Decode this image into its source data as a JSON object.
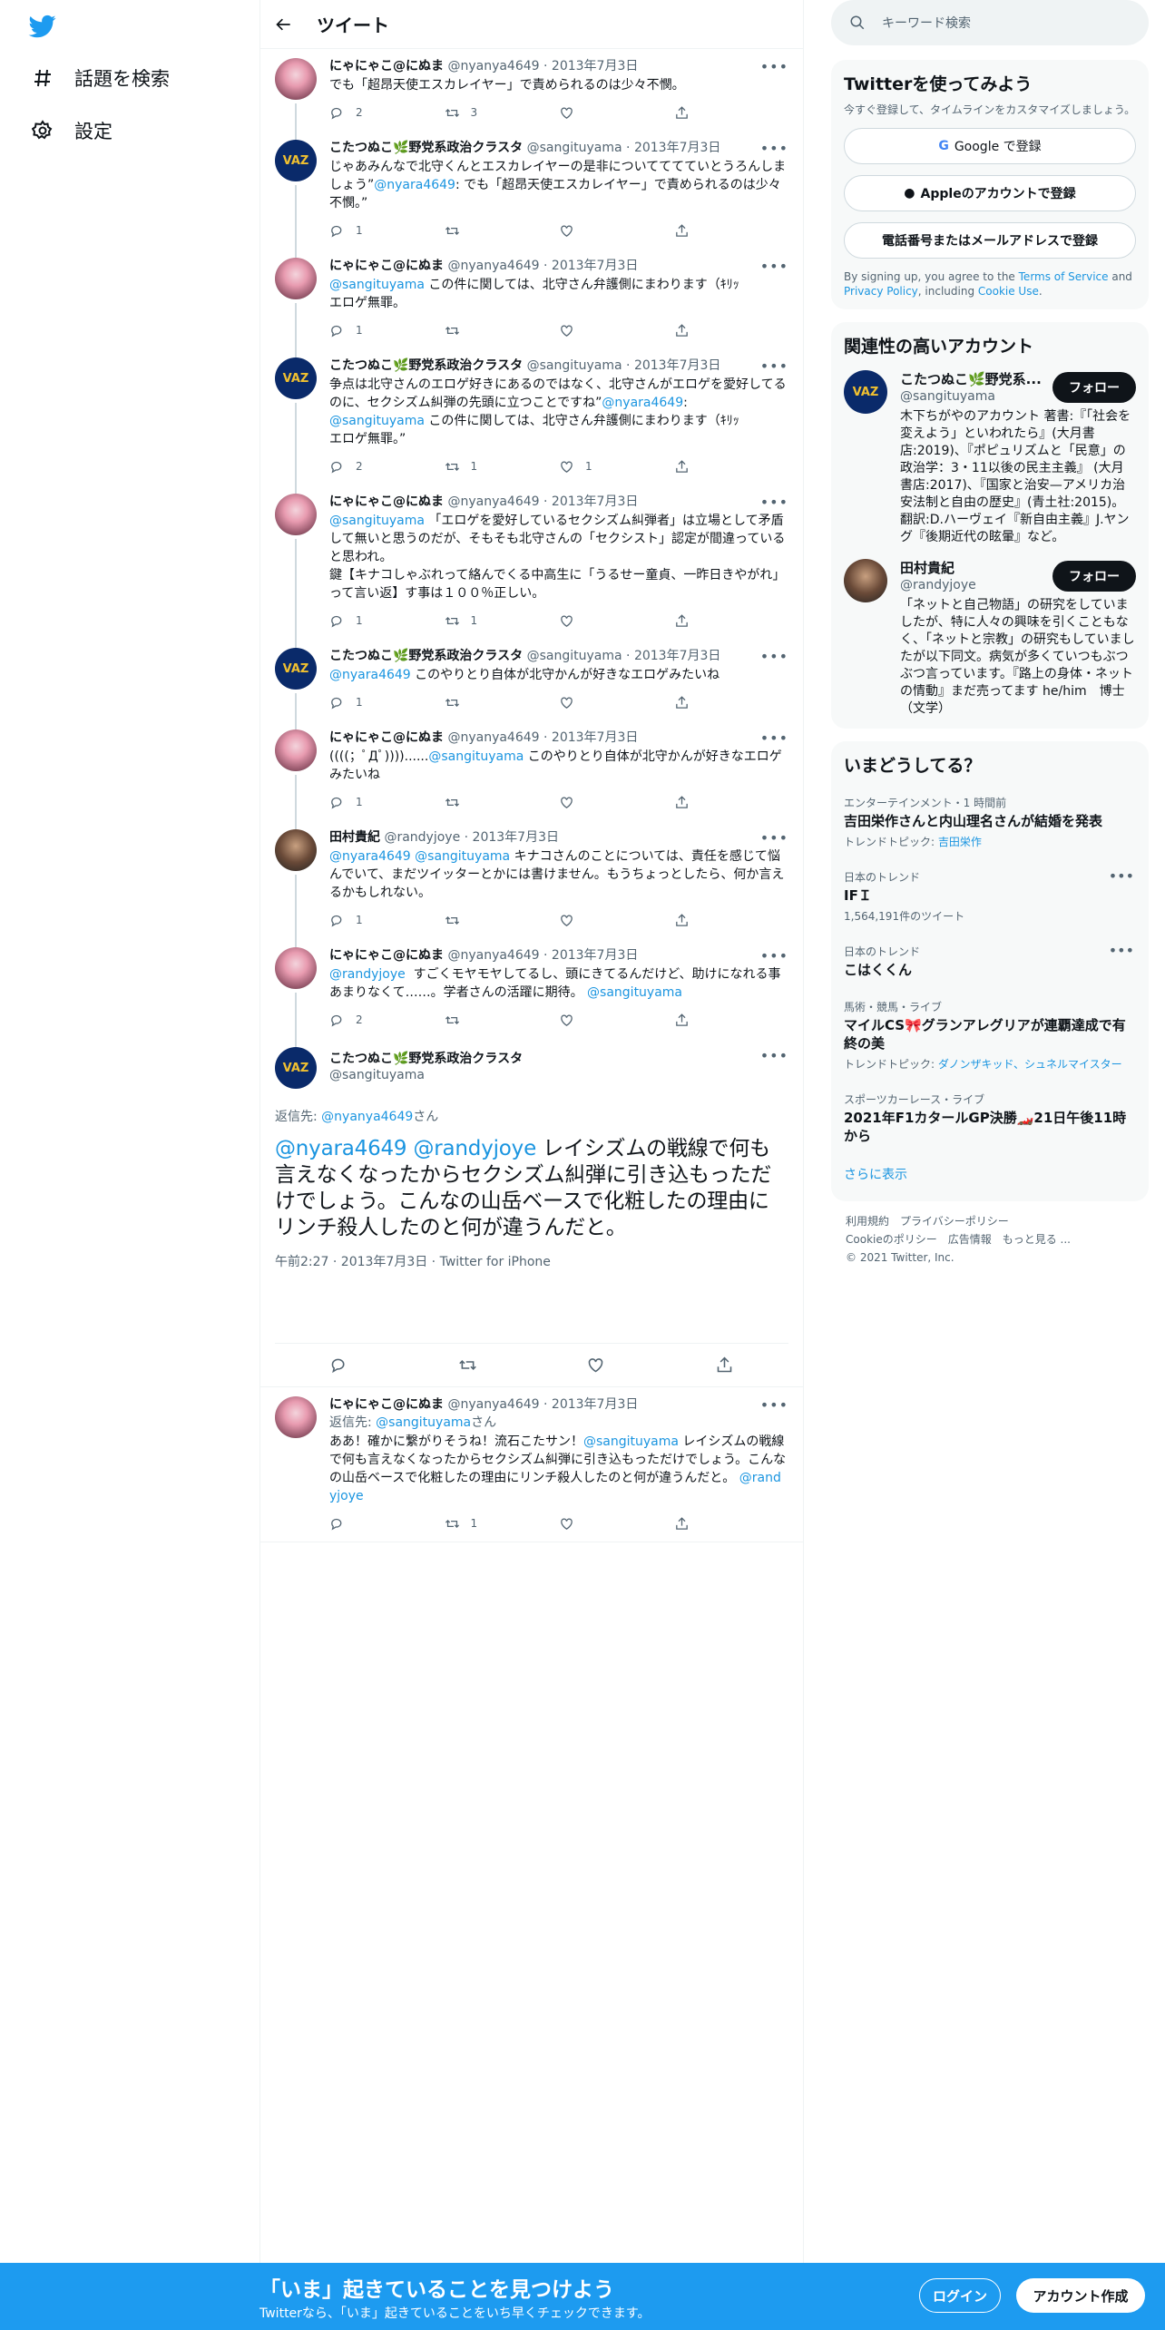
{
  "nav": {
    "explore": "話題を検索",
    "settings": "設定"
  },
  "header": {
    "title": "ツイート"
  },
  "tweets": [
    {
      "name": "にゃにゃこ@にぬま",
      "handle": "@nyanya4649",
      "date": "2013年7月3日",
      "text": "でも「超昂天使エスカレイヤー」で責められるのは少々不憫。",
      "reply": "2",
      "rt": "3",
      "like": ""
    },
    {
      "name": "こたつぬこ🌿野党系政治クラスタ",
      "handle": "@sangituyama",
      "date": "2013年7月3日",
      "text_pre": "じゃあみんなで北守くんとエスカレイヤーの是非についてててていとうろんしましょう”",
      "mention": "@nyara4649",
      "text_post": ": でも「超昂天使エスカレイヤー」で責められるのは少々不憫。”",
      "reply": "1",
      "rt": "",
      "like": ""
    },
    {
      "name": "にゃにゃこ@にぬま",
      "handle": "@nyanya4649",
      "date": "2013年7月3日",
      "mention": "@sangituyama",
      "text": " この件に関しては、北守さん弁護側にまわります（ｷﾘｯ\nエロゲ無罪。",
      "reply": "1",
      "rt": "",
      "like": ""
    },
    {
      "name": "こたつぬこ🌿野党系政治クラスタ",
      "handle": "@sangituyama",
      "date": "2013年7月3日",
      "text_pre": "争点は北守さんのエロゲ好きにあるのではなく、北守さんがエロゲを愛好してるのに、セクシズム糾弾の先頭に立つことですね”",
      "mention": "@nyara4649",
      "text_mid": ":\n",
      "mention2": "@sangituyama",
      "text_post": " この件に関しては、北守さん弁護側にまわります（ｷﾘｯ\nエロゲ無罪。”",
      "reply": "2",
      "rt": "1",
      "like": "1"
    },
    {
      "name": "にゃにゃこ@にぬま",
      "handle": "@nyanya4649",
      "date": "2013年7月3日",
      "mention": "@sangituyama",
      "text": " 「エロゲを愛好しているセクシズム糾弾者」は立場として矛盾して無いと思うのだが、そもそも北守さんの「セクシスト」認定が間違っていると思われ。\n鍵【キナコしゃぶれって絡んでくる中高生に「うるせー童貞、一昨日きやがれ」って言い返】す事は１００％正しい。",
      "reply": "1",
      "rt": "1",
      "like": ""
    },
    {
      "name": "こたつぬこ🌿野党系政治クラスタ",
      "handle": "@sangituyama",
      "date": "2013年7月3日",
      "mention": "@nyara4649",
      "text": " このやりとり自体が北守かんが好きなエロゲみたいね",
      "reply": "1",
      "rt": "",
      "like": ""
    },
    {
      "name": "にゃにゃこ@にぬま",
      "handle": "@nyanya4649",
      "date": "2013年7月3日",
      "text_pre": "((((；ﾟДﾟ))))......",
      "mention": "@sangituyama",
      "text": " このやりとり自体が北守かんが好きなエロゲみたいね",
      "reply": "1",
      "rt": "",
      "like": ""
    },
    {
      "name": "田村貴紀",
      "handle": "@randyjoye",
      "date": "2013年7月3日",
      "mention": "@nyara4649 @sangituyama",
      "text": " キナコさんのことについては、責任を感じて悩んでいて、まだツイッターとかには書けません。もうちょっとしたら、何か言えるかもしれない。",
      "reply": "1",
      "rt": "",
      "like": ""
    },
    {
      "name": "にゃにゃこ@にぬま",
      "handle": "@nyanya4649",
      "date": "2013年7月3日",
      "mention": "@randyjoye",
      "text": "  すごくモヤモヤしてるし、頭にきてるんだけど、助けになれる事あまりなくて……。学者さんの活躍に期待。",
      "mention_end": "@sangituyama",
      "reply": "2",
      "rt": "",
      "like": ""
    }
  ],
  "focus": {
    "name": "こたつぬこ🌿野党系政治クラスタ",
    "handle": "@sangituyama",
    "reply_label": "返信先: ",
    "reply_to": "@nyanya4649",
    "reply_suffix": "さん",
    "mention": "@nyara4649 @randyjoye",
    "text": " レイシズムの戦線で何も言えなくなったからセクシズム糾弾に引き込もっただけでしょう。こんなの山岳ベースで化粧したの理由にリンチ殺人したのと何が違うんだと。",
    "meta": "午前2:27 · 2013年7月3日 · Twitter for iPhone"
  },
  "last": {
    "name": "にゃにゃこ@にぬま",
    "handle": "@nyanya4649",
    "date": "2013年7月3日",
    "reply_label": "返信先: ",
    "reply_to": "@sangituyama",
    "reply_suffix": "さん",
    "text_pre": "ああ！確かに繋がりそうね！流石こたサン！",
    "mention": "@sangituyama",
    "text": " レイシズムの戦線で何も言えなくなったからセクシズム糾弾に引き込もっただけでしょう。こんなの山岳ベースで化粧したの理由にリンチ殺人したのと何が違うんだと。",
    "mention_end": "@randyjoye",
    "reply": "",
    "rt": "1",
    "like": ""
  },
  "sidebar": {
    "search_placeholder": "キーワード検索",
    "join": {
      "title": "Twitterを使ってみよう",
      "sub": "今すぐ登録して、タイムラインをカスタマイズしましょう。",
      "google": "Google で登録",
      "apple": "Appleのアカウントで登録",
      "phone": "電話番号またはメールアドレスで登録",
      "legal_pre": "By signing up, you agree to the ",
      "tos": "Terms of Service",
      "legal_and": " and ",
      "privacy": "Privacy Policy",
      "legal_inc": ", including ",
      "cookie": "Cookie Use",
      "legal_end": "."
    },
    "related": {
      "title": "関連性の高いアカウント",
      "follow": "フォロー",
      "a1": {
        "name": "こたつぬこ🌿野党系...",
        "handle": "@sangituyama",
        "bio": "木下ちがやのアカウント 著書:『「社会を変えよう」といわれたら』(大月書店:2019)、『ポピュリズムと「民意」の政治学：3・11以後の民主主義』 (大月書店:2017)、『国家と治安—アメリカ治安法制と自由の歴史』(青土社:2015)。翻訳:D.ハーヴェイ『新自由主義』J.ヤング『後期近代の眩暈』など。"
      },
      "a2": {
        "name": "田村貴紀",
        "handle": "@randyjoye",
        "bio": "「ネットと自己物語」の研究をしていましたが、特に人々の興味を引くこともなく、「ネットと宗教」の研究もしていましたが以下同文。病気が多くていつもぶつぶつ言っています。『路上の身体・ネットの情動』まだ売ってます he/him　博士（文学）"
      }
    },
    "trends": {
      "title": "いまどうしてる？",
      "t1": {
        "cat": "エンターテインメント・1 時間前",
        "name": "吉田栄作さんと内山理名さんが結婚を発表",
        "sub_pre": "トレンドトピック: ",
        "sub_link": "吉田栄作"
      },
      "t2": {
        "cat": "日本のトレンド",
        "name": "IFＩ",
        "sub": "1,564,191件のツイート"
      },
      "t3": {
        "cat": "日本のトレンド",
        "name": "こはくくん"
      },
      "t4": {
        "cat": "馬術・競馬・ライブ",
        "name": "マイルCS🎀グランアレグリアが連覇達成で有終の美",
        "sub_pre": "トレンドトピック: ",
        "sub_link": "ダノンザキッド、シュネルマイスター"
      },
      "t5": {
        "cat": "スポーツカーレース・ライブ",
        "name": "2021年F1カタールGP決勝🏎️21日午後11時から"
      },
      "more": "さらに表示"
    },
    "footer": {
      "l1": "利用規約　プライバシーポリシー",
      "l2": "Cookieのポリシー　広告情報　もっと見る ...",
      "l3": "© 2021 Twitter, Inc."
    }
  },
  "bottom": {
    "title": "「いま」起きていることを見つけよう",
    "sub": "Twitterなら、「いま」起きていることをいち早くチェックできます。",
    "login": "ログイン",
    "signup": "アカウント作成"
  }
}
